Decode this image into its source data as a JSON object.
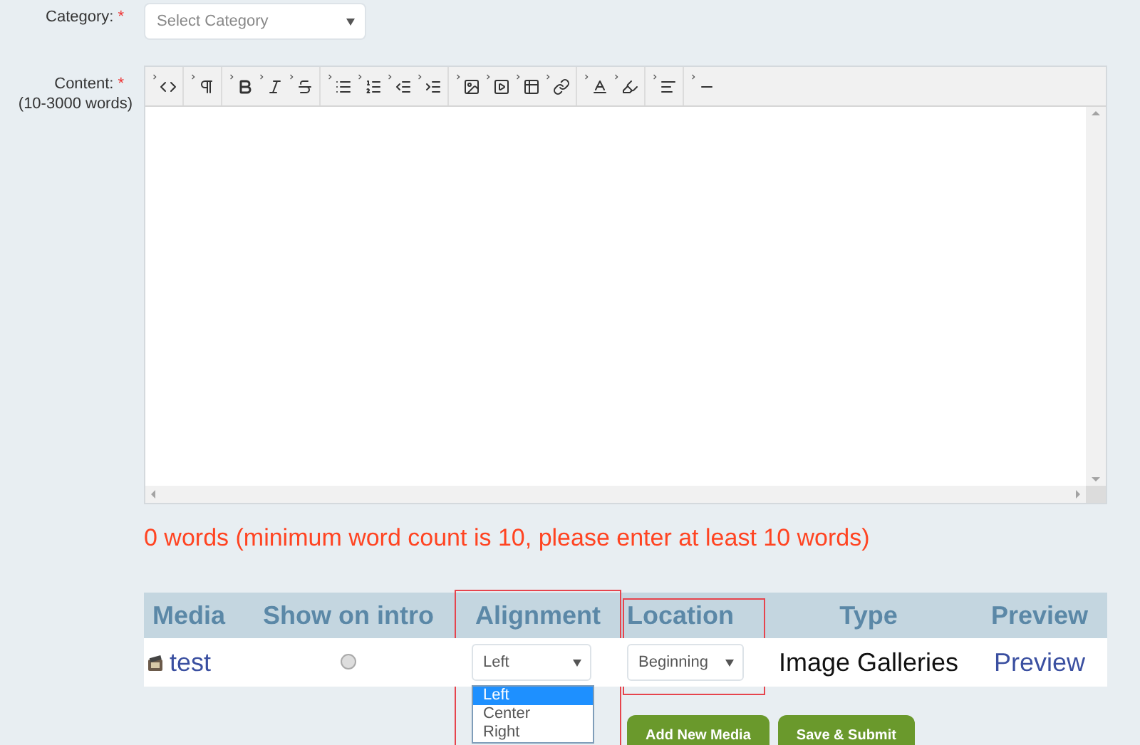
{
  "category": {
    "label": "Category:",
    "required_mark": "*",
    "placeholder": "Select Category"
  },
  "content": {
    "label": "Content:",
    "required_mark": "*",
    "hint": "(10-3000 words)",
    "toolbar": [
      {
        "tools": [
          {
            "kind": "code"
          }
        ]
      },
      {
        "tools": [
          {
            "kind": "paragraph"
          }
        ]
      },
      {
        "tools": [
          {
            "kind": "bold"
          },
          {
            "kind": "italic"
          },
          {
            "kind": "strike"
          }
        ]
      },
      {
        "tools": [
          {
            "kind": "list"
          },
          {
            "kind": "ordered"
          },
          {
            "kind": "outdent"
          },
          {
            "kind": "indent"
          }
        ]
      },
      {
        "tools": [
          {
            "kind": "image"
          },
          {
            "kind": "video"
          },
          {
            "kind": "table"
          },
          {
            "kind": "link"
          }
        ]
      },
      {
        "tools": [
          {
            "kind": "fontcolor"
          },
          {
            "kind": "backcolor"
          }
        ]
      },
      {
        "tools": [
          {
            "kind": "align"
          }
        ]
      },
      {
        "tools": [
          {
            "kind": "rule"
          }
        ]
      }
    ]
  },
  "word_count": "0 words (minimum word count is 10, please enter at least 10 words)",
  "media_table": {
    "columns": [
      {
        "label": "Media",
        "highlighted": false
      },
      {
        "label": "Show on intro",
        "highlighted": false
      },
      {
        "label": "Alignment",
        "highlighted": true
      },
      {
        "label": "Location",
        "highlighted": true
      },
      {
        "label": "Type",
        "highlighted": false
      },
      {
        "label": "Preview",
        "highlighted": false
      }
    ],
    "rows": [
      {
        "media": "test",
        "show_on_intro": false,
        "alignment": {
          "value": "Left",
          "expanded": true,
          "options": [
            {
              "label": "Left",
              "selected": true
            },
            {
              "label": "Center",
              "selected": false
            },
            {
              "label": "Right",
              "selected": false
            }
          ]
        },
        "location": {
          "value": "Beginning",
          "expanded": false
        },
        "type": "Image Galleries",
        "preview": "Preview"
      }
    ]
  },
  "buttons": [
    "Add New Media",
    "Save & Submit"
  ]
}
